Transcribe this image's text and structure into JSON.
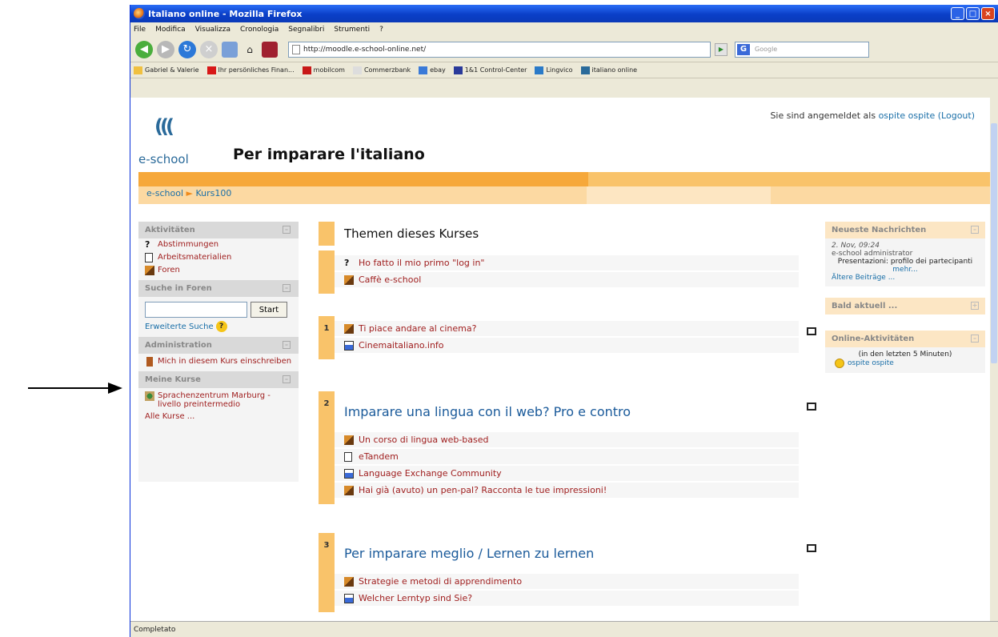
{
  "window": {
    "title": "Italiano online - Mozilla Firefox"
  },
  "menu": [
    "File",
    "Modifica",
    "Visualizza",
    "Cronologia",
    "Segnalibri",
    "Strumenti",
    "?"
  ],
  "nav": {
    "url": "http://moodle.e-school-online.net/",
    "search_placeholder": "Google"
  },
  "bookmarks": [
    {
      "label": "Gabriel & Valerie",
      "color": "#f0c040"
    },
    {
      "label": "Ihr persönliches Finan...",
      "color": "#d81818"
    },
    {
      "label": "mobilcom",
      "color": "#c81818"
    },
    {
      "label": "Commerzbank",
      "color": "#dddddd"
    },
    {
      "label": "ebay",
      "color": "#3a7ad8"
    },
    {
      "label": "1&1 Control-Center",
      "color": "#2a3a9a"
    },
    {
      "label": "Lingvico",
      "color": "#2a7ac8"
    },
    {
      "label": "italiano online",
      "color": "#2a6a9a"
    }
  ],
  "status": "Completato",
  "page": {
    "login_prefix": "Sie sind angemeldet als",
    "login_user": "ospite ospite",
    "logout": "(Logout)",
    "logo_text": "e-school",
    "site_title": "Per imparare l'italiano",
    "breadcrumb": {
      "home": "e-school",
      "sep": "►",
      "course": "Kurs100"
    }
  },
  "left": {
    "activities": {
      "title": "Aktivitäten",
      "items": [
        {
          "label": "Abstimmungen",
          "icon": "question-icon"
        },
        {
          "label": "Arbeitsmaterialien",
          "icon": "document-icon"
        },
        {
          "label": "Foren",
          "icon": "forum-icon"
        }
      ]
    },
    "search": {
      "title": "Suche in Foren",
      "button": "Start",
      "advanced": "Erweiterte Suche"
    },
    "admin": {
      "title": "Administration",
      "item": "Mich in diesem Kurs einschreiben"
    },
    "courses": {
      "title": "Meine Kurse",
      "item": "Sprachenzentrum Marburg - livello preintermedio",
      "all": "Alle Kurse ..."
    }
  },
  "main": {
    "header": "Themen dieses Kurses",
    "sections": [
      {
        "num": "",
        "title": "",
        "items": [
          {
            "label": "Ho fatto il mio primo \"log in\"",
            "icon": "question-icon"
          },
          {
            "label": "Caffè e-school",
            "icon": "forum-icon"
          }
        ]
      },
      {
        "num": "1",
        "title": "",
        "items": [
          {
            "label": "Ti piace andare al cinema?",
            "icon": "forum-icon"
          },
          {
            "label": "Cinemaitaliano.info",
            "icon": "web-icon"
          }
        ]
      },
      {
        "num": "2",
        "title": "Imparare una lingua con il web? Pro e contro",
        "items": [
          {
            "label": "Un corso di lingua web-based",
            "icon": "forum-icon"
          },
          {
            "label": "eTandem",
            "icon": "document-icon"
          },
          {
            "label": "Language Exchange Community",
            "icon": "web-icon"
          },
          {
            "label": "Hai già (avuto) un pen-pal? Racconta le tue impressioni!",
            "icon": "forum-icon"
          }
        ]
      },
      {
        "num": "3",
        "title": "Per imparare meglio / Lernen zu lernen",
        "items": [
          {
            "label": "Strategie e metodi di apprendimento",
            "icon": "forum-icon"
          },
          {
            "label": "Welcher Lerntyp sind Sie?",
            "icon": "web-icon"
          }
        ]
      }
    ]
  },
  "right": {
    "news": {
      "title": "Neueste Nachrichten",
      "date": "2. Nov, 09:24",
      "author": "e-school administrator",
      "text": "Presentazioni: profilo dei partecipanti",
      "more": "mehr...",
      "older": "Ältere Beiträge ..."
    },
    "upcoming": {
      "title": "Bald aktuell ..."
    },
    "online": {
      "title": "Online-Aktivitäten",
      "period": "(in den letzten 5 Minuten)",
      "user": "ospite ospite"
    }
  }
}
